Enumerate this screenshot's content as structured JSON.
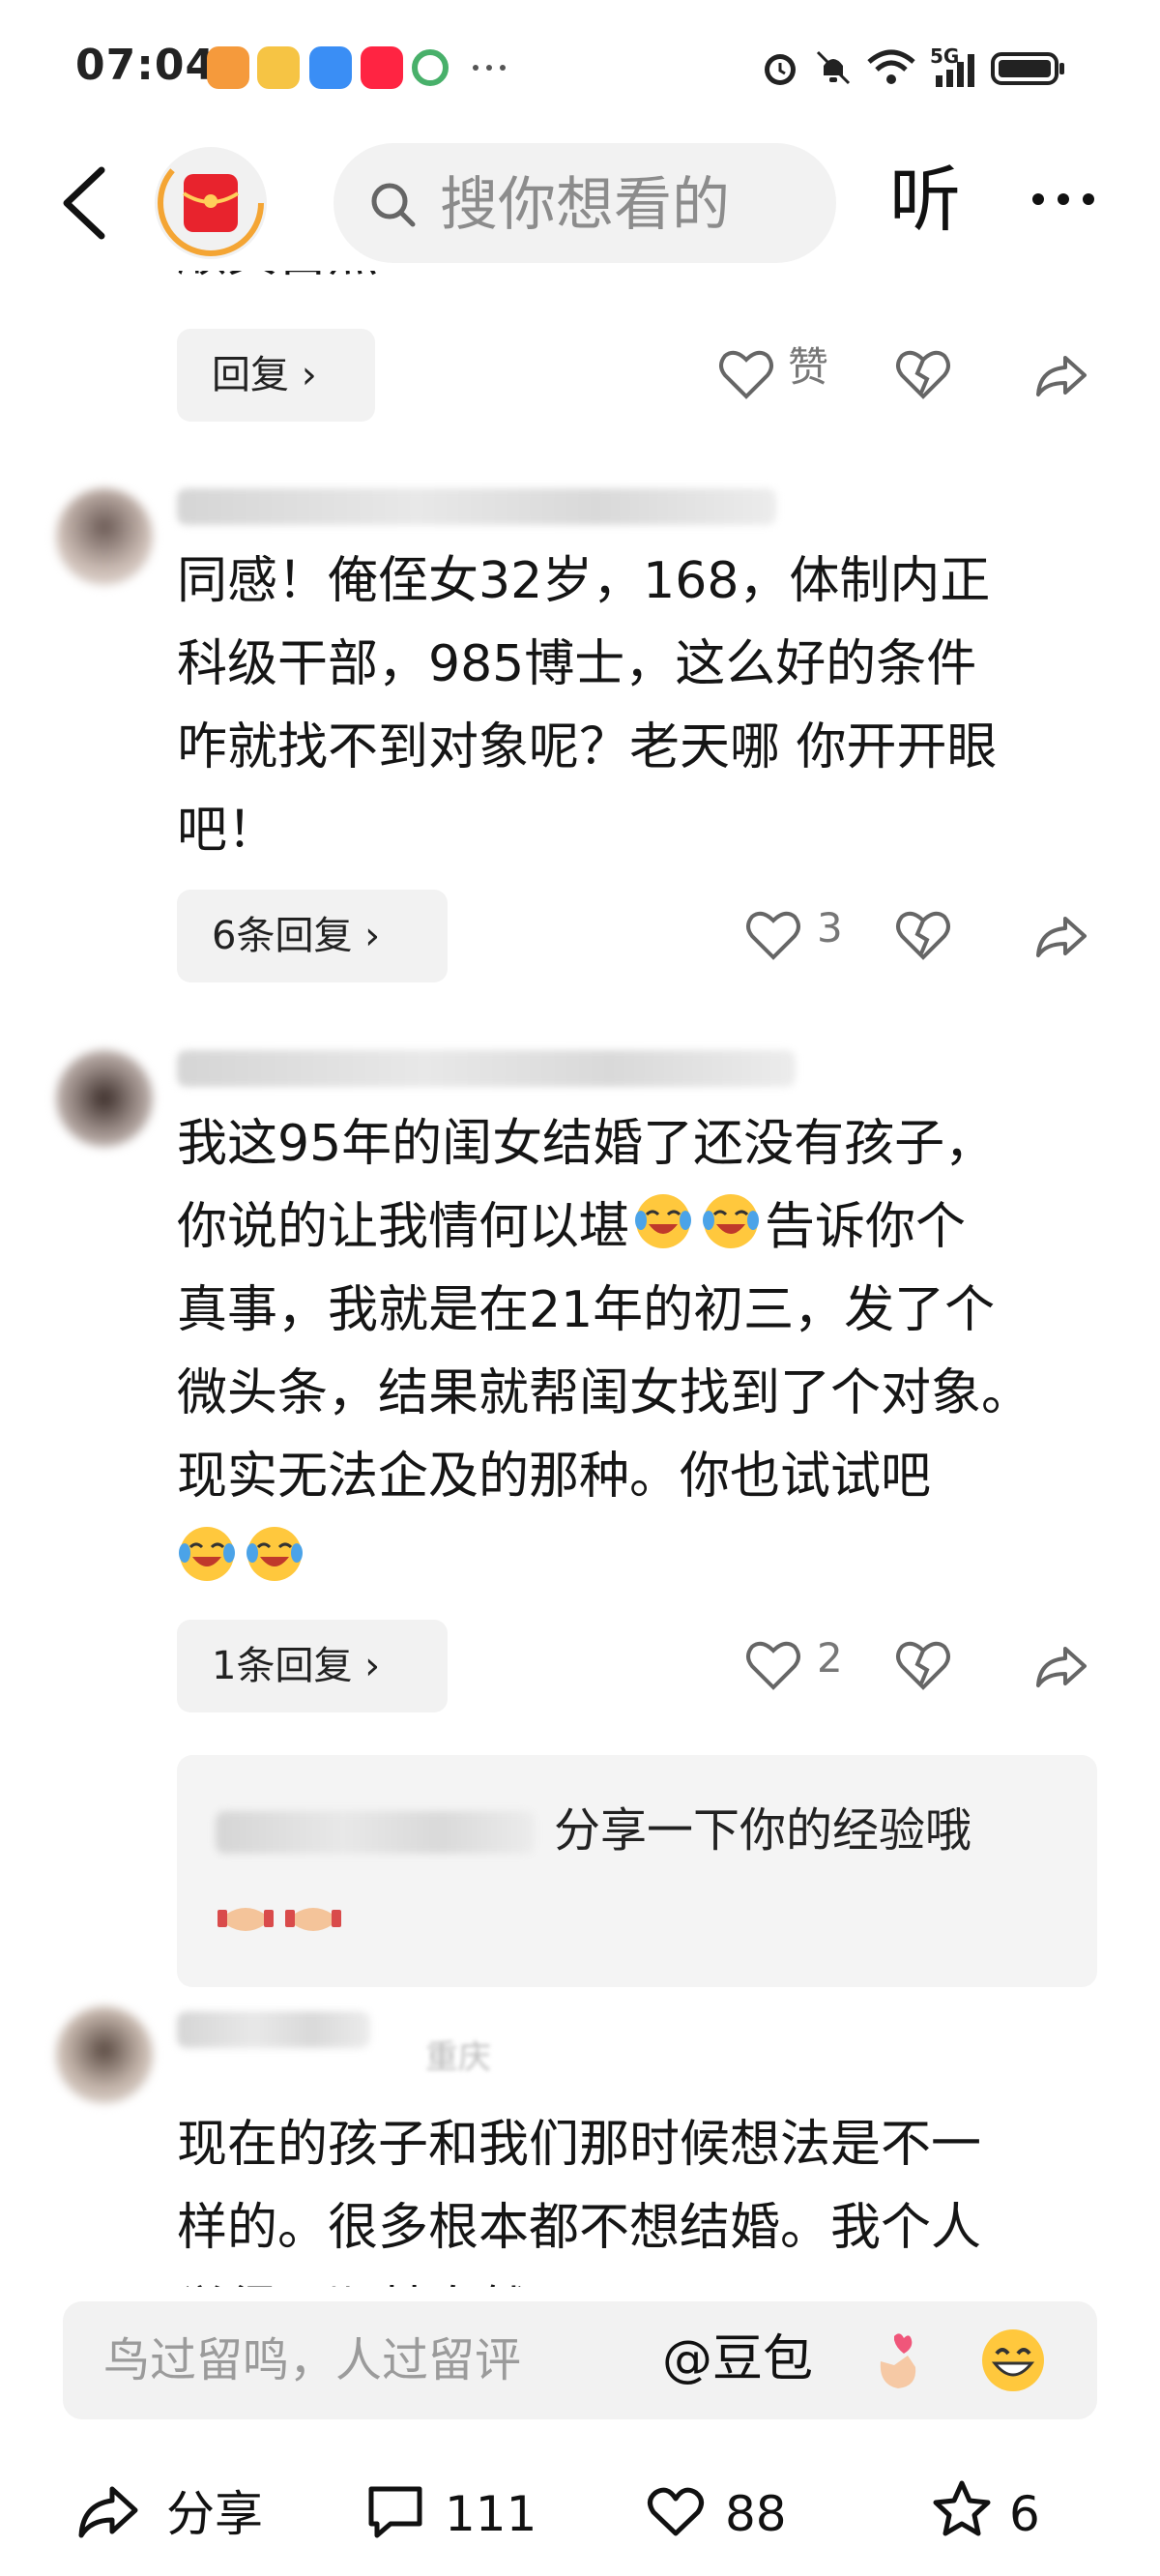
{
  "status_bar": {
    "time": "07:04",
    "signal_label": "5G"
  },
  "header": {
    "search_placeholder": "搜你想看的",
    "listen_label": "听"
  },
  "comments": [
    {
      "text": "顺其自然",
      "reply_label": "回复",
      "like_label": "赞"
    },
    {
      "text_lines": [
        "同感！俺侄女32岁，168，体制内正",
        "科级干部，985博士，这么好的条件",
        "咋就找不到对象呢？老天哪 你开开眼",
        "吧！"
      ],
      "reply_label": "6条回复",
      "likes": "3"
    },
    {
      "text_lines": [
        "我这95年的闺女结婚了还没有孩子，",
        "你说的让我情何以堪",
        "告诉你个",
        "真事，我就是在21年的初三，发了个",
        "微头条，结果就帮闺女找到了个对象。",
        "现实无法企及的那种。你也试试吧"
      ],
      "reply_label": "1条回复",
      "likes": "2",
      "sub_reply_text": "分享一下你的经验哦"
    },
    {
      "name_suffix": "重庆",
      "text_lines": [
        "现在的孩子和我们那时候想法是不一",
        "样的。很多根本都不想结婚。我个人",
        "觉得，顺其自然吧。"
      ]
    }
  ],
  "comment_input": {
    "placeholder": "鸟过留鸣，人过留评",
    "mention_label": "@豆包"
  },
  "toolbar": {
    "share_label": "分享",
    "comments_count": "111",
    "likes_count": "88",
    "favorites_count": "6"
  },
  "colors": {
    "accent_red": "#e8232d",
    "emoji_yellow": "#ffc83d",
    "chip_bg": "#f2f2f2"
  }
}
